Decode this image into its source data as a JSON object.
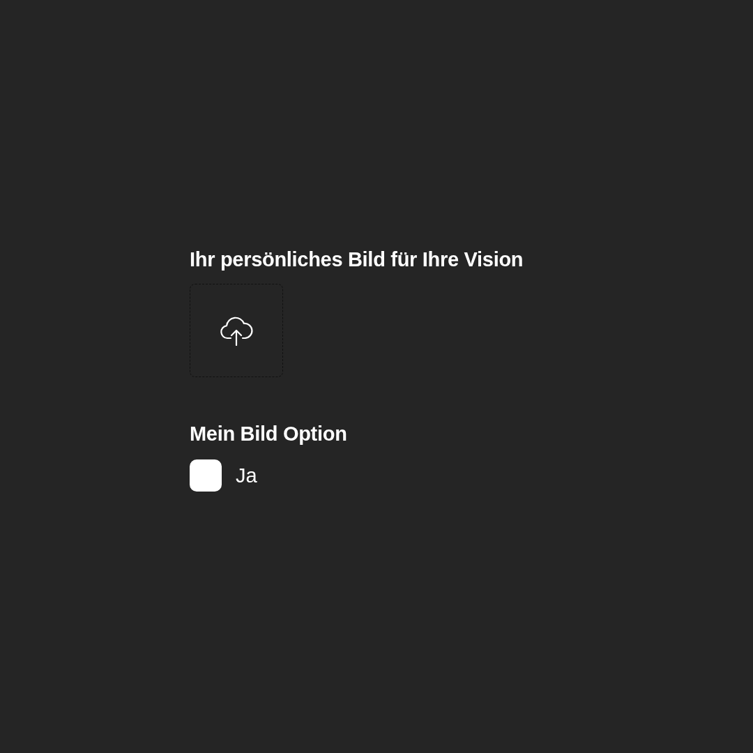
{
  "upload_section": {
    "title": "Ihr persönliches Bild für Ihre Vision"
  },
  "option_section": {
    "title": "Mein Bild Option",
    "options": [
      {
        "label": "Ja",
        "checked": false
      }
    ]
  }
}
